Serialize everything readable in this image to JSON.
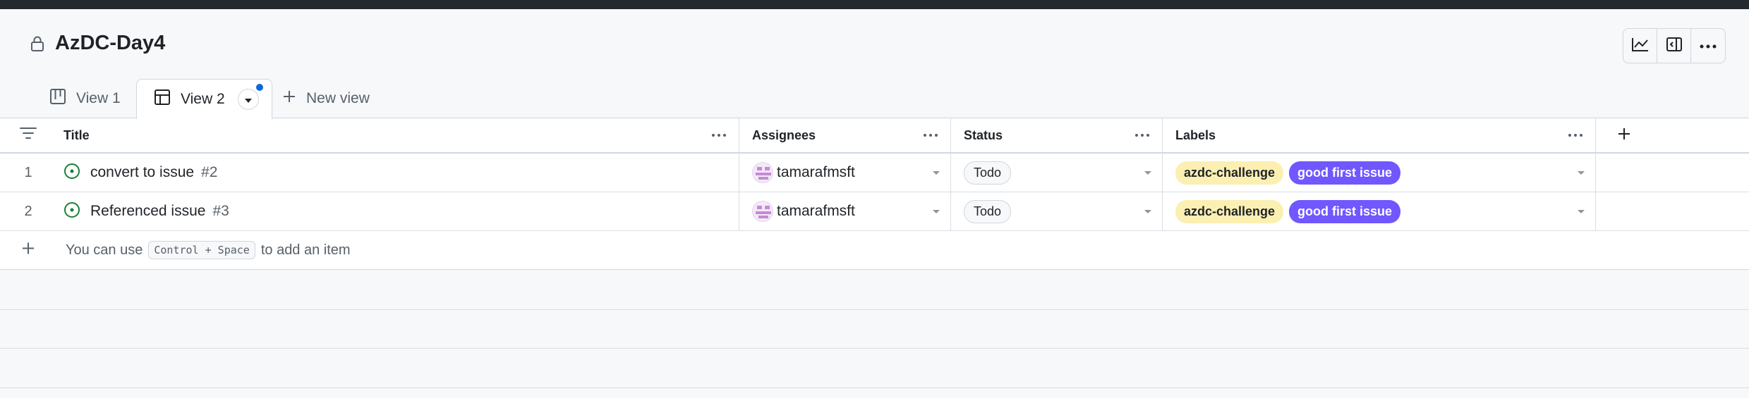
{
  "project": {
    "title": "AzDC-Day4"
  },
  "header_actions": [
    "insights-icon",
    "sidebar-panel-icon",
    "kebab-horizontal-icon"
  ],
  "tabs": [
    {
      "label": "View 1",
      "icon": "board-icon",
      "active": false
    },
    {
      "label": "View 2",
      "icon": "table-icon",
      "active": true,
      "unsaved": true
    },
    {
      "label": "New view",
      "icon": "plus-icon",
      "active": false
    }
  ],
  "table": {
    "columns": [
      "Title",
      "Assignees",
      "Status",
      "Labels"
    ],
    "rows": [
      {
        "index": "1",
        "title": "convert to issue",
        "number": "#2",
        "assignee": "tamarafmsft",
        "status": "Todo",
        "labels": [
          "azdc-challenge",
          "good first issue"
        ]
      },
      {
        "index": "2",
        "title": "Referenced issue",
        "number": "#3",
        "assignee": "tamarafmsft",
        "status": "Todo",
        "labels": [
          "azdc-challenge",
          "good first issue"
        ]
      }
    ],
    "add_row": {
      "prefix": "You can use",
      "shortcut": "Control + Space",
      "suffix": "to add an item"
    }
  },
  "colors": {
    "accent": "#0969da",
    "open_issue": "#1a7f37",
    "label_yellow": "#fbefb2",
    "label_purple": "#7057ff"
  }
}
